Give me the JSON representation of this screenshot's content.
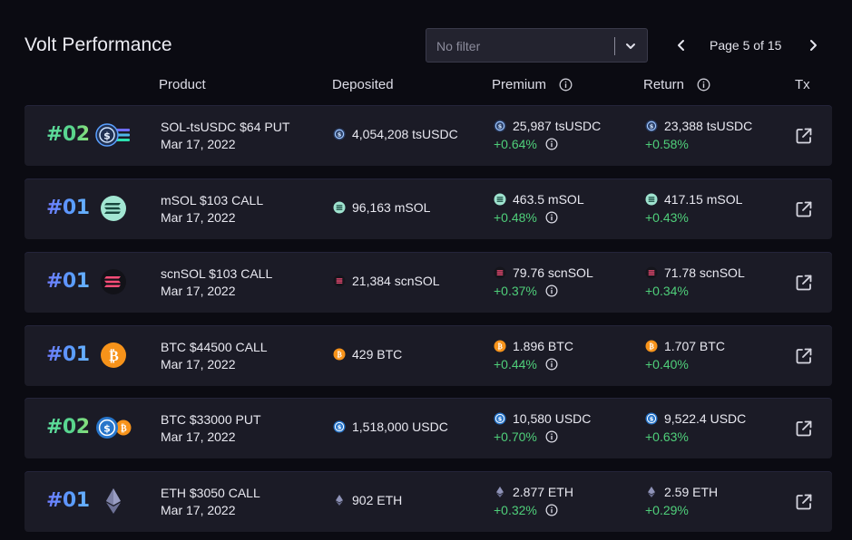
{
  "header": {
    "title": "Volt Performance",
    "filter_placeholder": "No filter",
    "pagination": "Page 5 of 15"
  },
  "columns": {
    "product": "Product",
    "deposited": "Deposited",
    "premium": "Premium",
    "return": "Return",
    "tx": "Tx"
  },
  "colors": {
    "background": "#0b0b12",
    "row": "#1b1b26",
    "positive": "#4fcf7a",
    "rank_volt2": "#57d38c",
    "rank_volt1": "#5a9dff"
  },
  "rows": [
    {
      "rank": "#02",
      "volt": 2,
      "icon": "sol-tsusdc-icon",
      "coin_icon": "tsusdc-icon",
      "product": "SOL-tsUSDC $64 PUT",
      "date": "Mar 17, 2022",
      "deposited": "4,054,208 tsUSDC",
      "premium": "25,987 tsUSDC",
      "premium_pct": "+0.64%",
      "return": "23,388 tsUSDC",
      "return_pct": "+0.58%"
    },
    {
      "rank": "#01",
      "volt": 1,
      "icon": "msol-icon",
      "coin_icon": "msol-icon",
      "product": "mSOL $103 CALL",
      "date": "Mar 17, 2022",
      "deposited": "96,163 mSOL",
      "premium": "463.5 mSOL",
      "premium_pct": "+0.48%",
      "return": "417.15 mSOL",
      "return_pct": "+0.43%"
    },
    {
      "rank": "#01",
      "volt": 1,
      "icon": "scnsol-icon",
      "coin_icon": "scnsol-icon",
      "product": "scnSOL $103 CALL",
      "date": "Mar 17, 2022",
      "deposited": "21,384 scnSOL",
      "premium": "79.76 scnSOL",
      "premium_pct": "+0.37%",
      "return": "71.78 scnSOL",
      "return_pct": "+0.34%"
    },
    {
      "rank": "#01",
      "volt": 1,
      "icon": "btc-icon",
      "coin_icon": "btc-icon",
      "product": "BTC $44500 CALL",
      "date": "Mar 17, 2022",
      "deposited": "429 BTC",
      "premium": "1.896 BTC",
      "premium_pct": "+0.44%",
      "return": "1.707 BTC",
      "return_pct": "+0.40%"
    },
    {
      "rank": "#02",
      "volt": 2,
      "icon": "usdc-btc-icon",
      "coin_icon": "usdc-icon",
      "product": "BTC $33000 PUT",
      "date": "Mar 17, 2022",
      "deposited": "1,518,000 USDC",
      "premium": "10,580 USDC",
      "premium_pct": "+0.70%",
      "return": "9,522.4 USDC",
      "return_pct": "+0.63%"
    },
    {
      "rank": "#01",
      "volt": 1,
      "icon": "eth-icon",
      "coin_icon": "eth-icon",
      "product": "ETH $3050 CALL",
      "date": "Mar 17, 2022",
      "deposited": "902 ETH",
      "premium": "2.877 ETH",
      "premium_pct": "+0.32%",
      "return": "2.59 ETH",
      "return_pct": "+0.29%"
    }
  ]
}
